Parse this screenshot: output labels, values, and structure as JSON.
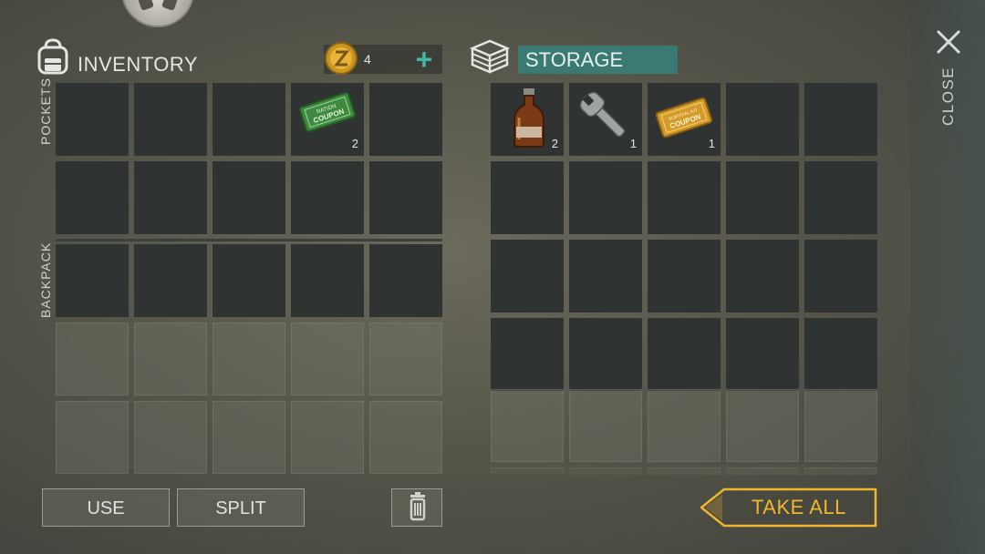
{
  "inventory": {
    "title": "INVENTORY",
    "coins": "4",
    "add_coins_label": "+",
    "pockets_label": "POCKETS",
    "backpack_label": "BACKPACK"
  },
  "storage": {
    "title": "STORAGE"
  },
  "close_label": "CLOSE",
  "pockets": [
    {
      "item": "",
      "qty": ""
    },
    {
      "item": "",
      "qty": ""
    },
    {
      "item": "",
      "qty": ""
    },
    {
      "item": "ration-coupon",
      "qty": "2"
    },
    {
      "item": "",
      "qty": ""
    },
    {
      "item": "",
      "qty": ""
    },
    {
      "item": "",
      "qty": ""
    },
    {
      "item": "",
      "qty": ""
    },
    {
      "item": "",
      "qty": ""
    },
    {
      "item": "",
      "qty": ""
    }
  ],
  "storage_slots": [
    {
      "item": "bottle",
      "qty": "2"
    },
    {
      "item": "wrench",
      "qty": "1"
    },
    {
      "item": "survival-kit-coupon",
      "qty": "1"
    }
  ],
  "item_text": {
    "ration_coupon": [
      "RATION",
      "COUPON"
    ],
    "survival_coupon": [
      "SURVIVAL KIT",
      "COUPON"
    ]
  },
  "actions": {
    "use": "USE",
    "split": "SPLIT",
    "take_all": "TAKE ALL"
  },
  "colors": {
    "accent_teal": "#3a7a72",
    "plus_teal": "#3fb9a5",
    "take_all_gold": "#f0b62e"
  }
}
